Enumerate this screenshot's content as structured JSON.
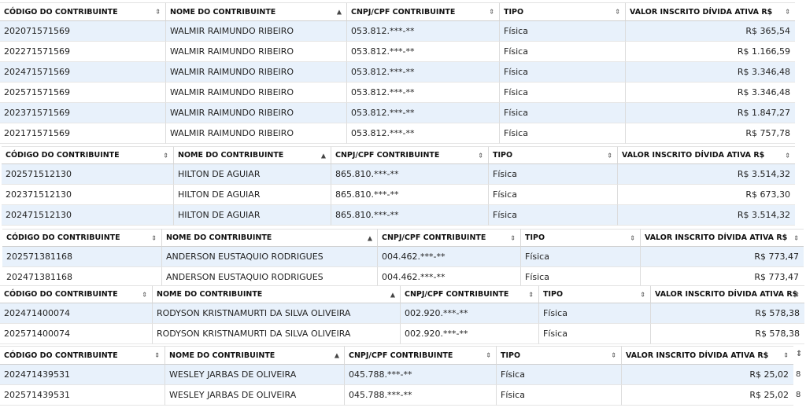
{
  "headers": {
    "codigo": "CÓDIGO DO CONTRIBUINTE",
    "nome": "NOME DO CONTRIBUINTE",
    "cnpj": "CNPJ/CPF CONTRIBUINTE",
    "tipo": "TIPO",
    "valor": "VALOR INSCRITO DÍVIDA ATIVA R$"
  },
  "sort_icons": {
    "unsorted": "⇕",
    "ascending": "▲"
  },
  "tables": [
    {
      "rows": [
        {
          "codigo": "202071571569",
          "nome": "WALMIR RAIMUNDO RIBEIRO",
          "cnpj": "053.812.***-**",
          "tipo": "Física",
          "valor": "R$ 365,54"
        },
        {
          "codigo": "202271571569",
          "nome": "WALMIR RAIMUNDO RIBEIRO",
          "cnpj": "053.812.***-**",
          "tipo": "Física",
          "valor": "R$ 1.166,59"
        },
        {
          "codigo": "202471571569",
          "nome": "WALMIR RAIMUNDO RIBEIRO",
          "cnpj": "053.812.***-**",
          "tipo": "Física",
          "valor": "R$ 3.346,48"
        },
        {
          "codigo": "202571571569",
          "nome": "WALMIR RAIMUNDO RIBEIRO",
          "cnpj": "053.812.***-**",
          "tipo": "Física",
          "valor": "R$ 3.346,48"
        },
        {
          "codigo": "202371571569",
          "nome": "WALMIR RAIMUNDO RIBEIRO",
          "cnpj": "053.812.***-**",
          "tipo": "Física",
          "valor": "R$ 1.847,27"
        },
        {
          "codigo": "202171571569",
          "nome": "WALMIR RAIMUNDO RIBEIRO",
          "cnpj": "053.812.***-**",
          "tipo": "Física",
          "valor": "R$ 757,78"
        }
      ]
    },
    {
      "rows": [
        {
          "codigo": "202571512130",
          "nome": "HILTON DE AGUIAR",
          "cnpj": "865.810.***-**",
          "tipo": "Física",
          "valor": "R$ 3.514,32"
        },
        {
          "codigo": "202371512130",
          "nome": "HILTON DE AGUIAR",
          "cnpj": "865.810.***-**",
          "tipo": "Física",
          "valor": "R$ 673,30"
        },
        {
          "codigo": "202471512130",
          "nome": "HILTON DE AGUIAR",
          "cnpj": "865.810.***-**",
          "tipo": "Física",
          "valor": "R$ 3.514,32"
        }
      ]
    },
    {
      "rows": [
        {
          "codigo": "202571381168",
          "nome": "ANDERSON EUSTAQUIO RODRIGUES",
          "cnpj": "004.462.***-**",
          "tipo": "Física",
          "valor": "R$ 773,47"
        },
        {
          "codigo": "202471381168",
          "nome": "ANDERSON EUSTAQUIO RODRIGUES",
          "cnpj": "004.462.***-**",
          "tipo": "Física",
          "valor": "R$ 773,47"
        }
      ]
    },
    {
      "rows": [
        {
          "codigo": "202471400074",
          "nome": "RODYSON KRISTNAMURTI DA SILVA OLIVEIRA",
          "cnpj": "002.920.***-**",
          "tipo": "Física",
          "valor": "R$ 578,38"
        },
        {
          "codigo": "202571400074",
          "nome": "RODYSON KRISTNAMURTI DA SILVA OLIVEIRA",
          "cnpj": "002.920.***-**",
          "tipo": "Física",
          "valor": "R$ 578,38"
        }
      ]
    },
    {
      "rows": [
        {
          "codigo": "202471439531",
          "nome": "WESLEY JARBAS DE OLIVEIRA",
          "cnpj": "045.788.***-**",
          "tipo": "Física",
          "valor": "R$ 25,02"
        },
        {
          "codigo": "202571439531",
          "nome": "WESLEY JARBAS DE OLIVEIRA",
          "cnpj": "045.788.***-**",
          "tipo": "Física",
          "valor": "R$ 25,02"
        }
      ]
    }
  ],
  "clipped": {
    "last_table_extra_sort": "⇕",
    "last_table_extra_cell": "8"
  },
  "colors": {
    "row_alt": "#e8f1fb",
    "border": "#d9d9d9"
  }
}
